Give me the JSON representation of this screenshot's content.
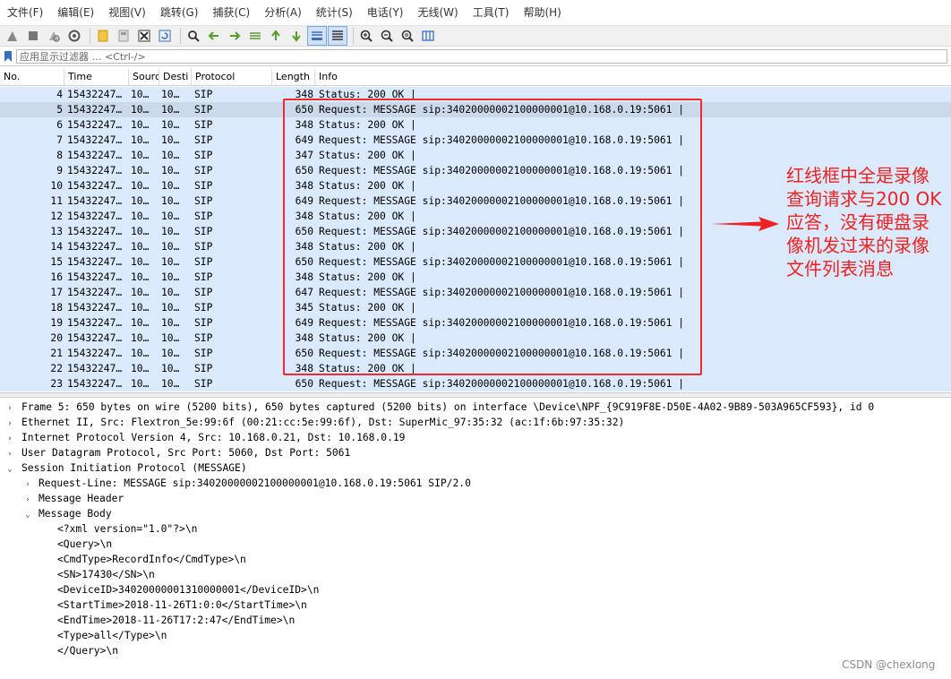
{
  "menu": [
    "文件(F)",
    "编辑(E)",
    "视图(V)",
    "跳转(G)",
    "捕获(C)",
    "分析(A)",
    "统计(S)",
    "电话(Y)",
    "无线(W)",
    "工具(T)",
    "帮助(H)"
  ],
  "filter": {
    "placeholder": "应用显示过滤器 … <Ctrl-/>"
  },
  "columns": {
    "no": "No.",
    "time": "Time",
    "src": "Sourc",
    "dst": "Desti",
    "proto": "Protocol",
    "len": "Length",
    "info": "Info"
  },
  "packets": [
    {
      "no": "4",
      "time": "15432247…",
      "src": "10…",
      "dst": "10…",
      "proto": "SIP",
      "len": "348",
      "info": "Status: 200 OK |"
    },
    {
      "no": "5",
      "time": "15432247…",
      "src": "10…",
      "dst": "10…",
      "proto": "SIP",
      "len": "650",
      "info": "Request: MESSAGE sip:34020000002100000001@10.168.0.19:5061 |"
    },
    {
      "no": "6",
      "time": "15432247…",
      "src": "10…",
      "dst": "10…",
      "proto": "SIP",
      "len": "348",
      "info": "Status: 200 OK |"
    },
    {
      "no": "7",
      "time": "15432247…",
      "src": "10…",
      "dst": "10…",
      "proto": "SIP",
      "len": "649",
      "info": "Request: MESSAGE sip:34020000002100000001@10.168.0.19:5061 |"
    },
    {
      "no": "8",
      "time": "15432247…",
      "src": "10…",
      "dst": "10…",
      "proto": "SIP",
      "len": "347",
      "info": "Status: 200 OK |"
    },
    {
      "no": "9",
      "time": "15432247…",
      "src": "10…",
      "dst": "10…",
      "proto": "SIP",
      "len": "650",
      "info": "Request: MESSAGE sip:34020000002100000001@10.168.0.19:5061 |"
    },
    {
      "no": "10",
      "time": "15432247…",
      "src": "10…",
      "dst": "10…",
      "proto": "SIP",
      "len": "348",
      "info": "Status: 200 OK |"
    },
    {
      "no": "11",
      "time": "15432247…",
      "src": "10…",
      "dst": "10…",
      "proto": "SIP",
      "len": "649",
      "info": "Request: MESSAGE sip:34020000002100000001@10.168.0.19:5061 |"
    },
    {
      "no": "12",
      "time": "15432247…",
      "src": "10…",
      "dst": "10…",
      "proto": "SIP",
      "len": "348",
      "info": "Status: 200 OK |"
    },
    {
      "no": "13",
      "time": "15432247…",
      "src": "10…",
      "dst": "10…",
      "proto": "SIP",
      "len": "650",
      "info": "Request: MESSAGE sip:34020000002100000001@10.168.0.19:5061 |"
    },
    {
      "no": "14",
      "time": "15432247…",
      "src": "10…",
      "dst": "10…",
      "proto": "SIP",
      "len": "348",
      "info": "Status: 200 OK |"
    },
    {
      "no": "15",
      "time": "15432247…",
      "src": "10…",
      "dst": "10…",
      "proto": "SIP",
      "len": "650",
      "info": "Request: MESSAGE sip:34020000002100000001@10.168.0.19:5061 |"
    },
    {
      "no": "16",
      "time": "15432247…",
      "src": "10…",
      "dst": "10…",
      "proto": "SIP",
      "len": "348",
      "info": "Status: 200 OK |"
    },
    {
      "no": "17",
      "time": "15432247…",
      "src": "10…",
      "dst": "10…",
      "proto": "SIP",
      "len": "647",
      "info": "Request: MESSAGE sip:34020000002100000001@10.168.0.19:5061 |"
    },
    {
      "no": "18",
      "time": "15432247…",
      "src": "10…",
      "dst": "10…",
      "proto": "SIP",
      "len": "345",
      "info": "Status: 200 OK |"
    },
    {
      "no": "19",
      "time": "15432247…",
      "src": "10…",
      "dst": "10…",
      "proto": "SIP",
      "len": "649",
      "info": "Request: MESSAGE sip:34020000002100000001@10.168.0.19:5061 |"
    },
    {
      "no": "20",
      "time": "15432247…",
      "src": "10…",
      "dst": "10…",
      "proto": "SIP",
      "len": "348",
      "info": "Status: 200 OK |"
    },
    {
      "no": "21",
      "time": "15432247…",
      "src": "10…",
      "dst": "10…",
      "proto": "SIP",
      "len": "650",
      "info": "Request: MESSAGE sip:34020000002100000001@10.168.0.19:5061 |"
    },
    {
      "no": "22",
      "time": "15432247…",
      "src": "10…",
      "dst": "10…",
      "proto": "SIP",
      "len": "348",
      "info": "Status: 200 OK |"
    },
    {
      "no": "23",
      "time": "15432247…",
      "src": "10…",
      "dst": "10…",
      "proto": "SIP",
      "len": "650",
      "info": "Request: MESSAGE sip:34020000002100000001@10.168.0.19:5061 |"
    }
  ],
  "annotation": {
    "lines": [
      "红线框中全是录像",
      "查询请求与200 OK",
      "应答，没有硬盘录",
      "像机发过来的录像",
      "文件列表消息"
    ],
    "color": "#ee2222"
  },
  "details": [
    {
      "arrow": "›",
      "indent": 0,
      "text": "Frame 5: 650 bytes on wire (5200 bits), 650 bytes captured (5200 bits) on interface \\Device\\NPF_{9C919F8E-D50E-4A02-9B89-503A965CF593}, id 0"
    },
    {
      "arrow": "›",
      "indent": 0,
      "text": "Ethernet II, Src: Flextron_5e:99:6f (00:21:cc:5e:99:6f), Dst: SuperMic_97:35:32 (ac:1f:6b:97:35:32)"
    },
    {
      "arrow": "›",
      "indent": 0,
      "text": "Internet Protocol Version 4, Src: 10.168.0.21, Dst: 10.168.0.19"
    },
    {
      "arrow": "›",
      "indent": 0,
      "text": "User Datagram Protocol, Src Port: 5060, Dst Port: 5061"
    },
    {
      "arrow": "⌄",
      "indent": 0,
      "text": "Session Initiation Protocol (MESSAGE)"
    },
    {
      "arrow": "›",
      "indent": 1,
      "text": "Request-Line: MESSAGE sip:34020000002100000001@10.168.0.19:5061 SIP/2.0"
    },
    {
      "arrow": "›",
      "indent": 1,
      "text": "Message Header"
    },
    {
      "arrow": "⌄",
      "indent": 1,
      "text": "Message Body"
    },
    {
      "arrow": "",
      "indent": 2,
      "text": "<?xml version=\"1.0\"?>\\n"
    },
    {
      "arrow": "",
      "indent": 2,
      "text": "<Query>\\n"
    },
    {
      "arrow": "",
      "indent": 2,
      "text": "<CmdType>RecordInfo</CmdType>\\n"
    },
    {
      "arrow": "",
      "indent": 2,
      "text": "<SN>17430</SN>\\n"
    },
    {
      "arrow": "",
      "indent": 2,
      "text": "<DeviceID>34020000001310000001</DeviceID>\\n"
    },
    {
      "arrow": "",
      "indent": 2,
      "text": "<StartTime>2018-11-26T1:0:0</StartTime>\\n"
    },
    {
      "arrow": "",
      "indent": 2,
      "text": "<EndTime>2018-11-26T17:2:47</EndTime>\\n"
    },
    {
      "arrow": "",
      "indent": 2,
      "text": "<Type>all</Type>\\n"
    },
    {
      "arrow": "",
      "indent": 2,
      "text": "</Query>\\n"
    }
  ],
  "watermark": "CSDN @chexlong"
}
